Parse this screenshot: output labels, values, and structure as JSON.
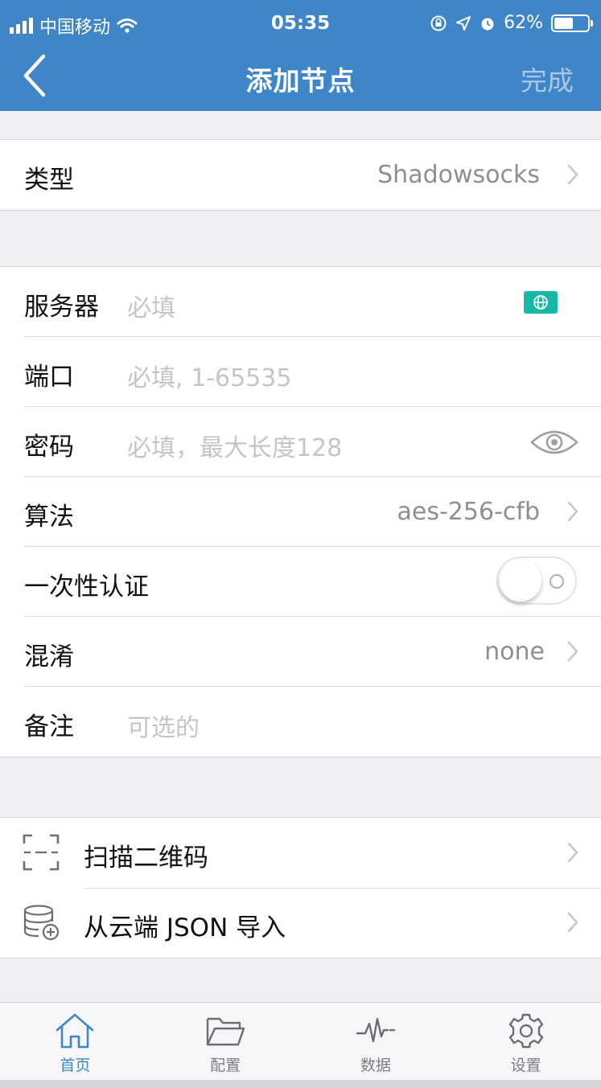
{
  "status_bar": {
    "carrier": "中国移动",
    "time": "05:35",
    "battery_percent": "62%",
    "battery_level": 0.62
  },
  "nav": {
    "title": "添加节点",
    "done_label": "完成"
  },
  "type_row": {
    "label": "类型",
    "value": "Shadowsocks"
  },
  "form": {
    "server": {
      "label": "服务器",
      "placeholder": "必填"
    },
    "port": {
      "label": "端口",
      "placeholder": "必填, 1-65535"
    },
    "password": {
      "label": "密码",
      "placeholder": "必填，最大长度128"
    },
    "cipher": {
      "label": "算法",
      "value": "aes-256-cfb"
    },
    "ota": {
      "label": "一次性认证",
      "enabled": false
    },
    "obfs": {
      "label": "混淆",
      "value": "none"
    },
    "remark": {
      "label": "备注",
      "placeholder": "可选的"
    }
  },
  "import": {
    "scan_label": "扫描二维码",
    "cloud_label": "从云端 JSON 导入"
  },
  "tabs": [
    {
      "label": "首页",
      "icon": "home-icon",
      "active": true
    },
    {
      "label": "配置",
      "icon": "folder-icon",
      "active": false
    },
    {
      "label": "数据",
      "icon": "pulse-icon",
      "active": false
    },
    {
      "label": "设置",
      "icon": "gear-icon",
      "active": false
    }
  ],
  "colors": {
    "accent": "#3f86c8",
    "globe_button": "#17b8a6",
    "placeholder": "#c5c5c9"
  }
}
